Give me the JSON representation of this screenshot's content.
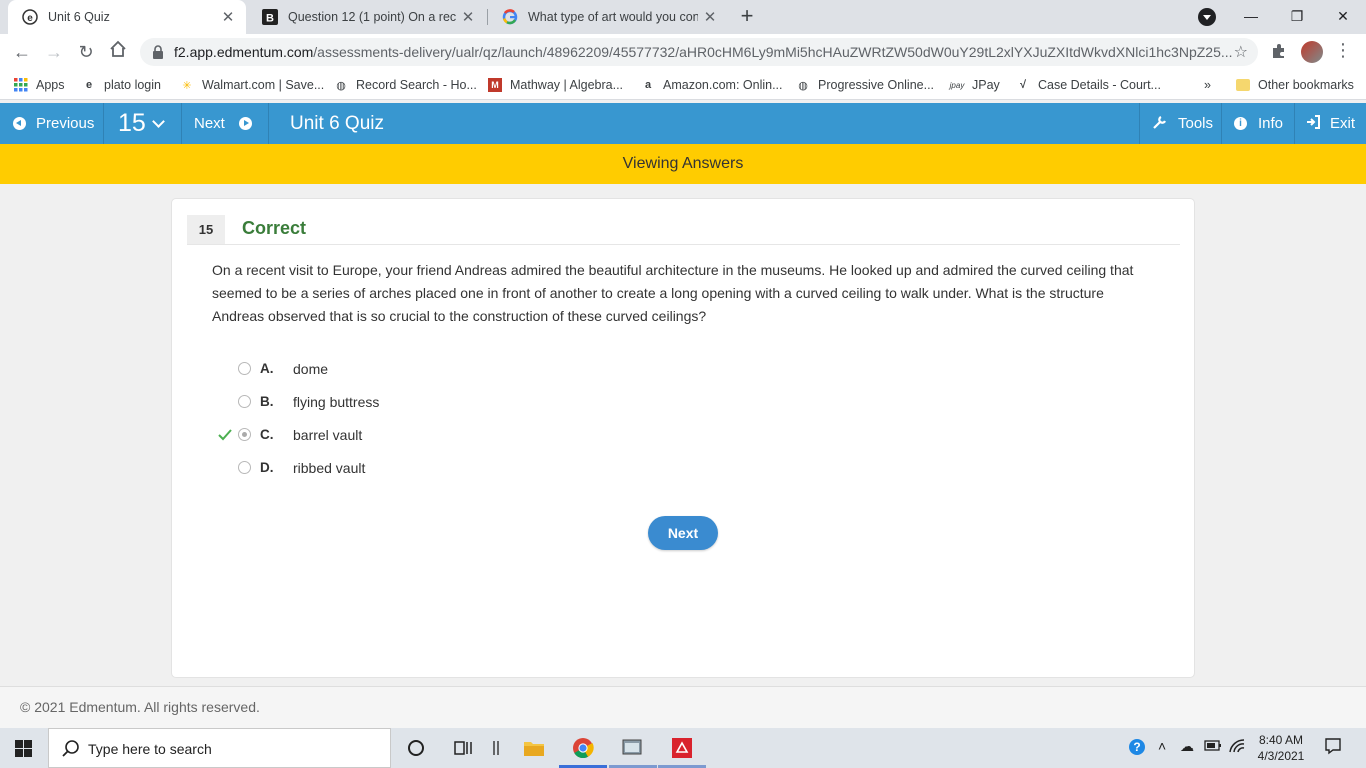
{
  "browser": {
    "tabs": [
      {
        "title": "Unit 6 Quiz",
        "active": true
      },
      {
        "title": "Question 12 (1 point) On a recent",
        "active": false
      },
      {
        "title": "What type of art would you cons",
        "active": false
      }
    ],
    "url_host": "f2.app.edmentum.com",
    "url_path": "/assessments-delivery/ualr/qz/launch/48962209/45577732/aHR0cHM6Ly9mMi5hcHAuZWRtZW50dW0uY29tL2xlYXJuZXItdWkvdXNlci1hc3NpZ25...",
    "bookmarks": [
      "Apps",
      "plato login",
      "Walmart.com | Save...",
      "Record Search - Ho...",
      "Mathway | Algebra...",
      "Amazon.com: Onlin...",
      "Progressive Online...",
      "JPay",
      "Case Details - Court..."
    ],
    "more_bookmarks": "»",
    "other_bookmarks": "Other bookmarks"
  },
  "appbar": {
    "previous_label": "Previous",
    "question_number": "15",
    "next_label": "Next",
    "title": "Unit 6 Quiz",
    "tools_label": "Tools",
    "info_label": "Info",
    "exit_label": "Exit"
  },
  "banner": "Viewing Answers",
  "question": {
    "number": "15",
    "status": "Correct",
    "text": "On a recent visit to Europe, your friend Andreas admired the beautiful architecture in the museums. He looked up and admired the curved ceiling that seemed to be a series of arches placed one in front of another to create a long opening with a curved ceiling to walk under. What is the structure Andreas observed that is so crucial to the construction of these curved ceilings?",
    "choices": [
      {
        "letter": "A.",
        "text": "dome",
        "selected": false,
        "correct": false
      },
      {
        "letter": "B.",
        "text": "flying buttress",
        "selected": false,
        "correct": false
      },
      {
        "letter": "C.",
        "text": "barrel vault",
        "selected": true,
        "correct": true
      },
      {
        "letter": "D.",
        "text": "ribbed vault",
        "selected": false,
        "correct": false
      }
    ],
    "next_button": "Next"
  },
  "footer": "© 2021 Edmentum. All rights reserved.",
  "taskbar": {
    "search_placeholder": "Type here to search",
    "time": "8:40 AM",
    "date": "4/3/2021"
  },
  "colors": {
    "appbar": "#3897d0",
    "banner": "#ffcc00",
    "correct": "#3a7d3a",
    "next_button": "#3a8bd0"
  }
}
